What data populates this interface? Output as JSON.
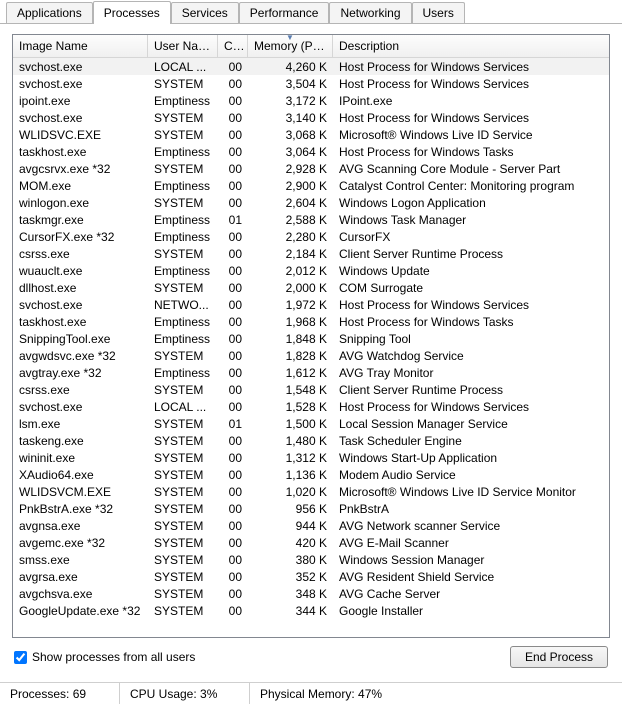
{
  "tabs": {
    "items": [
      "Applications",
      "Processes",
      "Services",
      "Performance",
      "Networking",
      "Users"
    ],
    "active_index": 1
  },
  "columns": {
    "image": "Image Name",
    "user": "User Name",
    "cpu": "CPU",
    "memory": "Memory (Priv...",
    "description": "Description",
    "sorted": "memory",
    "sort_dir": "desc"
  },
  "processes": [
    {
      "name": "svchost.exe",
      "user": "LOCAL ...",
      "cpu": "00",
      "mem": "4,260 K",
      "desc": "Host Process for Windows Services",
      "selected": true
    },
    {
      "name": "svchost.exe",
      "user": "SYSTEM",
      "cpu": "00",
      "mem": "3,504 K",
      "desc": "Host Process for Windows Services"
    },
    {
      "name": "ipoint.exe",
      "user": "Emptiness",
      "cpu": "00",
      "mem": "3,172 K",
      "desc": "IPoint.exe"
    },
    {
      "name": "svchost.exe",
      "user": "SYSTEM",
      "cpu": "00",
      "mem": "3,140 K",
      "desc": "Host Process for Windows Services"
    },
    {
      "name": "WLIDSVC.EXE",
      "user": "SYSTEM",
      "cpu": "00",
      "mem": "3,068 K",
      "desc": "Microsoft® Windows Live ID Service"
    },
    {
      "name": "taskhost.exe",
      "user": "Emptiness",
      "cpu": "00",
      "mem": "3,064 K",
      "desc": "Host Process for Windows Tasks"
    },
    {
      "name": "avgcsrvx.exe *32",
      "user": "SYSTEM",
      "cpu": "00",
      "mem": "2,928 K",
      "desc": "AVG Scanning Core Module - Server Part"
    },
    {
      "name": "MOM.exe",
      "user": "Emptiness",
      "cpu": "00",
      "mem": "2,900 K",
      "desc": "Catalyst Control Center: Monitoring program"
    },
    {
      "name": "winlogon.exe",
      "user": "SYSTEM",
      "cpu": "00",
      "mem": "2,604 K",
      "desc": "Windows Logon Application"
    },
    {
      "name": "taskmgr.exe",
      "user": "Emptiness",
      "cpu": "01",
      "mem": "2,588 K",
      "desc": "Windows Task Manager"
    },
    {
      "name": "CursorFX.exe *32",
      "user": "Emptiness",
      "cpu": "00",
      "mem": "2,280 K",
      "desc": "CursorFX"
    },
    {
      "name": "csrss.exe",
      "user": "SYSTEM",
      "cpu": "00",
      "mem": "2,184 K",
      "desc": "Client Server Runtime Process"
    },
    {
      "name": "wuauclt.exe",
      "user": "Emptiness",
      "cpu": "00",
      "mem": "2,012 K",
      "desc": "Windows Update"
    },
    {
      "name": "dllhost.exe",
      "user": "SYSTEM",
      "cpu": "00",
      "mem": "2,000 K",
      "desc": "COM Surrogate"
    },
    {
      "name": "svchost.exe",
      "user": "NETWO...",
      "cpu": "00",
      "mem": "1,972 K",
      "desc": "Host Process for Windows Services"
    },
    {
      "name": "taskhost.exe",
      "user": "Emptiness",
      "cpu": "00",
      "mem": "1,968 K",
      "desc": "Host Process for Windows Tasks"
    },
    {
      "name": "SnippingTool.exe",
      "user": "Emptiness",
      "cpu": "00",
      "mem": "1,848 K",
      "desc": "Snipping Tool"
    },
    {
      "name": "avgwdsvc.exe *32",
      "user": "SYSTEM",
      "cpu": "00",
      "mem": "1,828 K",
      "desc": "AVG Watchdog Service"
    },
    {
      "name": "avgtray.exe *32",
      "user": "Emptiness",
      "cpu": "00",
      "mem": "1,612 K",
      "desc": "AVG Tray Monitor"
    },
    {
      "name": "csrss.exe",
      "user": "SYSTEM",
      "cpu": "00",
      "mem": "1,548 K",
      "desc": "Client Server Runtime Process"
    },
    {
      "name": "svchost.exe",
      "user": "LOCAL ...",
      "cpu": "00",
      "mem": "1,528 K",
      "desc": "Host Process for Windows Services"
    },
    {
      "name": "lsm.exe",
      "user": "SYSTEM",
      "cpu": "01",
      "mem": "1,500 K",
      "desc": "Local Session Manager Service"
    },
    {
      "name": "taskeng.exe",
      "user": "SYSTEM",
      "cpu": "00",
      "mem": "1,480 K",
      "desc": "Task Scheduler Engine"
    },
    {
      "name": "wininit.exe",
      "user": "SYSTEM",
      "cpu": "00",
      "mem": "1,312 K",
      "desc": "Windows Start-Up Application"
    },
    {
      "name": "XAudio64.exe",
      "user": "SYSTEM",
      "cpu": "00",
      "mem": "1,136 K",
      "desc": "Modem Audio Service"
    },
    {
      "name": "WLIDSVCM.EXE",
      "user": "SYSTEM",
      "cpu": "00",
      "mem": "1,020 K",
      "desc": "Microsoft® Windows Live ID Service Monitor"
    },
    {
      "name": "PnkBstrA.exe *32",
      "user": "SYSTEM",
      "cpu": "00",
      "mem": "956 K",
      "desc": "PnkBstrA"
    },
    {
      "name": "avgnsa.exe",
      "user": "SYSTEM",
      "cpu": "00",
      "mem": "944 K",
      "desc": "AVG Network scanner Service"
    },
    {
      "name": "avgemc.exe *32",
      "user": "SYSTEM",
      "cpu": "00",
      "mem": "420 K",
      "desc": "AVG E-Mail Scanner"
    },
    {
      "name": "smss.exe",
      "user": "SYSTEM",
      "cpu": "00",
      "mem": "380 K",
      "desc": "Windows Session Manager"
    },
    {
      "name": "avgrsa.exe",
      "user": "SYSTEM",
      "cpu": "00",
      "mem": "352 K",
      "desc": "AVG Resident Shield Service"
    },
    {
      "name": "avgchsva.exe",
      "user": "SYSTEM",
      "cpu": "00",
      "mem": "348 K",
      "desc": "AVG Cache Server"
    },
    {
      "name": "GoogleUpdate.exe *32",
      "user": "SYSTEM",
      "cpu": "00",
      "mem": "344 K",
      "desc": "Google Installer"
    }
  ],
  "footer": {
    "show_all_label": "Show processes from all users",
    "show_all_checked": true,
    "end_process_label": "End Process"
  },
  "status": {
    "processes_label": "Processes: 69",
    "cpu_label": "CPU Usage: 3%",
    "mem_label": "Physical Memory: 47%"
  }
}
